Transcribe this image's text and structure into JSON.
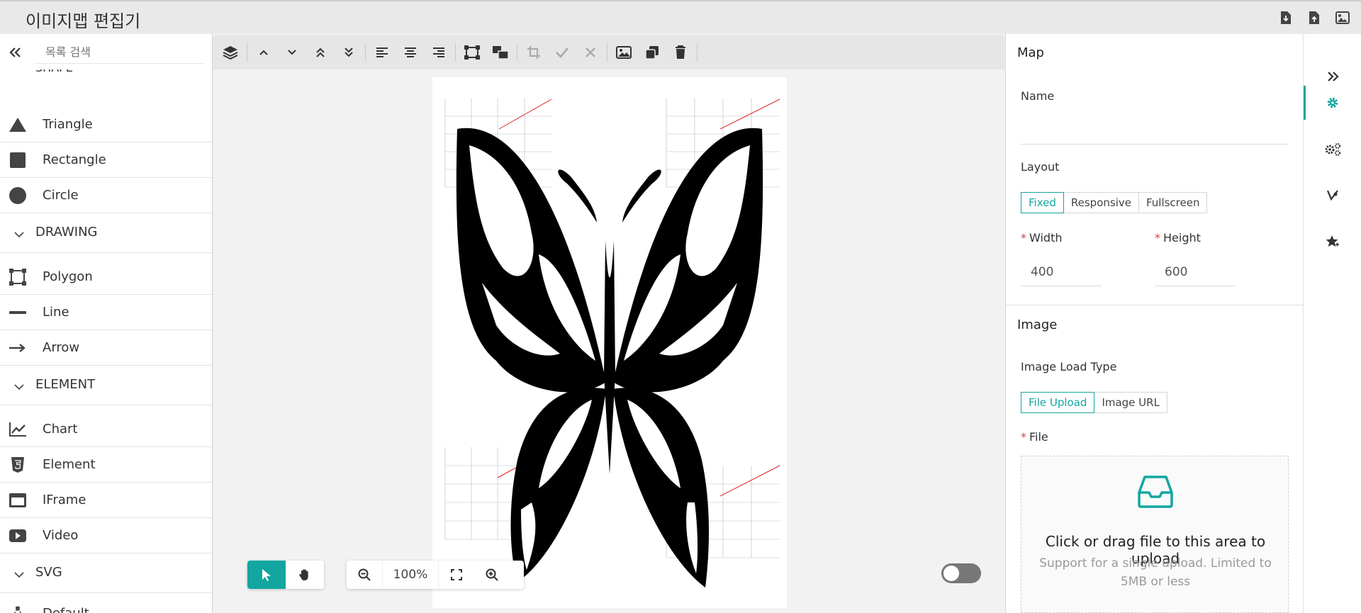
{
  "app": {
    "title": "이미지맵 편집기"
  },
  "top_actions": [
    "download-icon",
    "upload-icon",
    "image-icon"
  ],
  "left": {
    "search_placeholder": "목록 검색",
    "clipped_section": "SHAPE",
    "items": [
      {
        "label": "Triangle",
        "icon": "triangle-icon"
      },
      {
        "label": "Rectangle",
        "icon": "rectangle-icon"
      },
      {
        "label": "Circle",
        "icon": "circle-icon"
      },
      {
        "label": "Polygon",
        "icon": "polygon-icon"
      },
      {
        "label": "Line",
        "icon": "line-icon"
      },
      {
        "label": "Arrow",
        "icon": "arrow-icon"
      },
      {
        "label": "Chart",
        "icon": "chart-icon"
      },
      {
        "label": "Element",
        "icon": "html5-icon"
      },
      {
        "label": "IFrame",
        "icon": "iframe-icon"
      },
      {
        "label": "Video",
        "icon": "video-icon"
      },
      {
        "label": "Default",
        "icon": "default-svg-icon"
      }
    ],
    "sections": [
      "DRAWING",
      "ELEMENT",
      "SVG"
    ]
  },
  "canvas": {
    "zoom": "100%",
    "mode": "select",
    "grid_toggle": "off"
  },
  "right": {
    "map_title": "Map",
    "name_label": "Name",
    "name_value": "",
    "layout_label": "Layout",
    "layout_options": [
      "Fixed",
      "Responsive",
      "Fullscreen"
    ],
    "layout_selected": "Fixed",
    "width_label": "Width",
    "width_value": "400",
    "height_label": "Height",
    "height_value": "600",
    "image_title": "Image",
    "load_type_label": "Image Load Type",
    "load_type_options": [
      "File Upload",
      "Image URL"
    ],
    "load_type_selected": "File Upload",
    "file_label": "File",
    "upload_text": "Click or drag file to this area to upload",
    "upload_hint": "Support for a single upload. Limited to 5MB or less"
  },
  "colors": {
    "accent": "#13a6a1",
    "required": "#e03b3b"
  }
}
